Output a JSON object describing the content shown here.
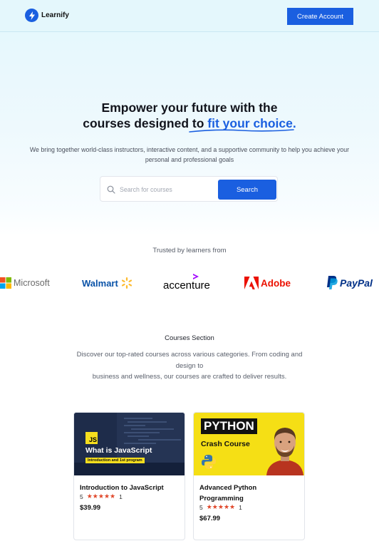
{
  "header": {
    "brand_name": "Learnify",
    "cta_label": "Create Account"
  },
  "hero": {
    "title_line1": "Empower your future with the",
    "title_line2_plain": "courses designed to ",
    "title_line2_highlight": "fit your choice.",
    "subtitle": "We bring together world-class instructors, interactive content, and a supportive community to help you achieve your personal and professional goals",
    "search_placeholder": "Search for courses",
    "search_button": "Search"
  },
  "trusted": {
    "title": "Trusted by learners from",
    "brands": [
      "Microsoft",
      "Walmart",
      "accenture",
      "Adobe",
      "PayPal"
    ]
  },
  "courses": {
    "title": "Courses Section",
    "description_line1": "Discover our top-rated courses across various categories. From coding and design to",
    "description_line2": "business and wellness, our courses are crafted to deliver results.",
    "items": [
      {
        "thumb_badge": "JS",
        "thumb_title": "What is JavaScript",
        "thumb_subtitle": "Introduction and 1st program",
        "title": "Introduction to JavaScript",
        "rating": "5",
        "stars": "★★★★★",
        "reviews": "1",
        "price": "$39.99"
      },
      {
        "thumb_title": "PYTHON",
        "thumb_subtitle": "Crash Course",
        "title": "Advanced Python Programming",
        "rating": "5",
        "stars": "★★★★★",
        "reviews": "1",
        "price": "$67.99"
      }
    ]
  },
  "colors": {
    "accent": "#1a5fe0",
    "header_bg": "#e4f7fc",
    "star": "#e0472a",
    "python_yellow": "#f5df15"
  },
  "icons": [
    "lightning-icon",
    "search-icon",
    "star-icon"
  ]
}
